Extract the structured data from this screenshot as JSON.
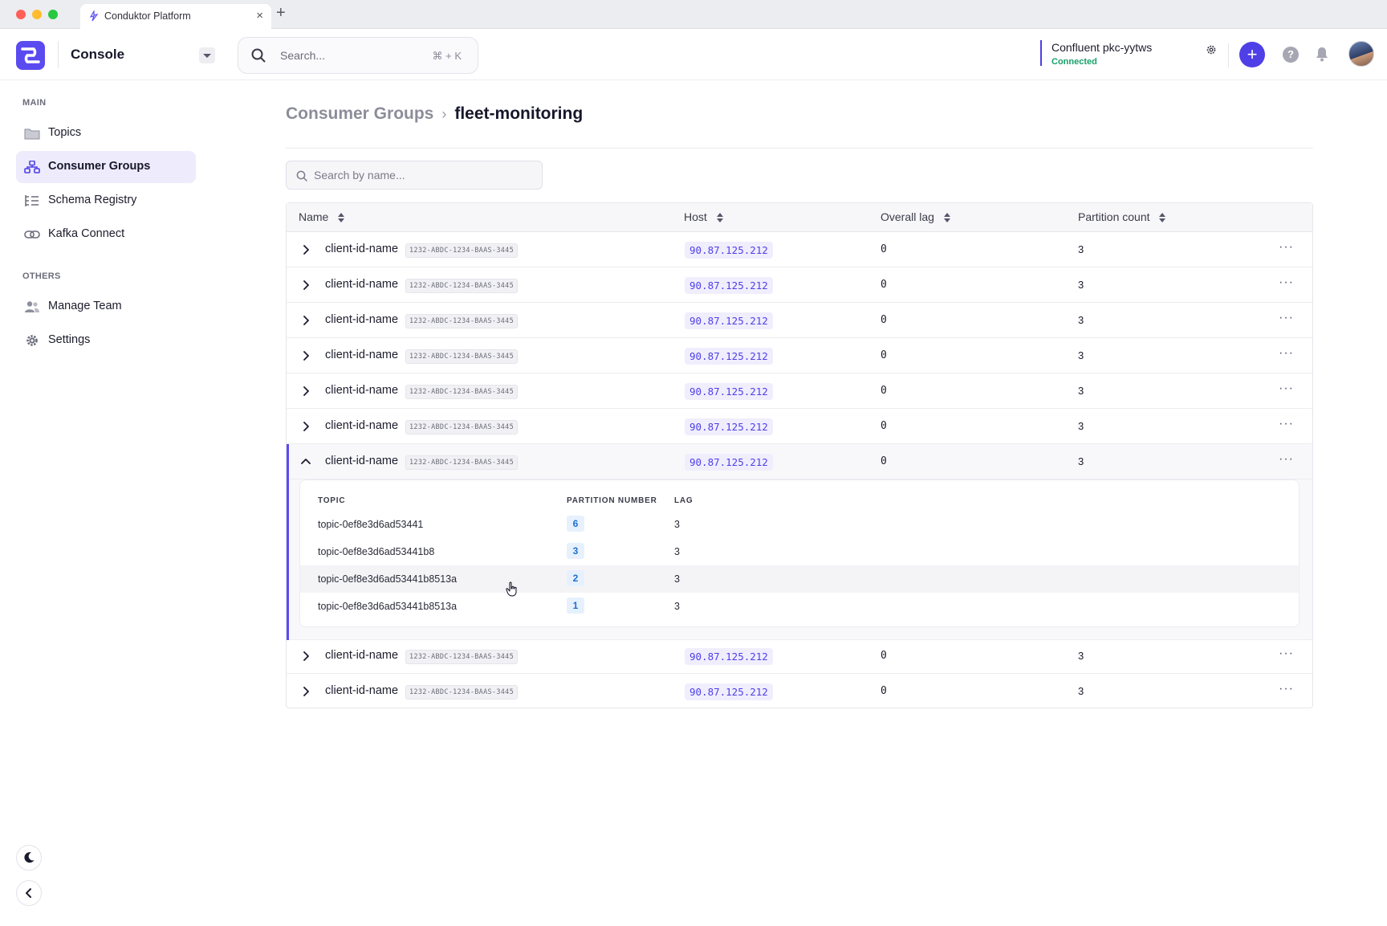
{
  "browser": {
    "tab_title": "Conduktor Platform",
    "close_glyph": "×",
    "new_tab_glyph": "+"
  },
  "header": {
    "app_name": "Console",
    "search_placeholder": "Search...",
    "search_shortcut": "⌘ + K",
    "cluster_name": "Confluent pkc-yytws",
    "cluster_status": "Connected",
    "help_glyph": "?",
    "add_glyph": "+",
    "accent_color": "#5a4bf0",
    "status_color": "#18a06a"
  },
  "sidebar": {
    "section_main": "MAIN",
    "section_others": "OTHERS",
    "items": [
      {
        "label": "Topics",
        "icon": "folder-icon"
      },
      {
        "label": "Consumer Groups",
        "icon": "consumer-groups-icon",
        "active": true
      },
      {
        "label": "Schema Registry",
        "icon": "schema-list-icon"
      },
      {
        "label": "Kafka Connect",
        "icon": "link-icon"
      },
      {
        "label": "Manage Team",
        "icon": "users-icon"
      },
      {
        "label": "Settings",
        "icon": "gear-icon"
      }
    ]
  },
  "breadcrumb": {
    "parent": "Consumer Groups",
    "separator": "›",
    "current": "fleet-monitoring"
  },
  "filter": {
    "placeholder": "Search by name..."
  },
  "table": {
    "columns": [
      "Name",
      "Host",
      "Overall lag",
      "Partition count"
    ],
    "rows": [
      {
        "name": "client-id-name",
        "id": "1232-ABDC-1234-BAAS-3445",
        "host": "90.87.125.212",
        "lag": "0",
        "partitions": "3"
      },
      {
        "name": "client-id-name",
        "id": "1232-ABDC-1234-BAAS-3445",
        "host": "90.87.125.212",
        "lag": "0",
        "partitions": "3"
      },
      {
        "name": "client-id-name",
        "id": "1232-ABDC-1234-BAAS-3445",
        "host": "90.87.125.212",
        "lag": "0",
        "partitions": "3"
      },
      {
        "name": "client-id-name",
        "id": "1232-ABDC-1234-BAAS-3445",
        "host": "90.87.125.212",
        "lag": "0",
        "partitions": "3"
      },
      {
        "name": "client-id-name",
        "id": "1232-ABDC-1234-BAAS-3445",
        "host": "90.87.125.212",
        "lag": "0",
        "partitions": "3"
      },
      {
        "name": "client-id-name",
        "id": "1232-ABDC-1234-BAAS-3445",
        "host": "90.87.125.212",
        "lag": "0",
        "partitions": "3"
      },
      {
        "name": "client-id-name",
        "id": "1232-ABDC-1234-BAAS-3445",
        "host": "90.87.125.212",
        "lag": "0",
        "partitions": "3",
        "expanded": true
      },
      {
        "name": "client-id-name",
        "id": "1232-ABDC-1234-BAAS-3445",
        "host": "90.87.125.212",
        "lag": "0",
        "partitions": "3"
      },
      {
        "name": "client-id-name",
        "id": "1232-ABDC-1234-BAAS-3445",
        "host": "90.87.125.212",
        "lag": "0",
        "partitions": "3"
      }
    ],
    "more_glyph": "···"
  },
  "expanded_detail": {
    "columns": [
      "TOPIC",
      "PARTITION NUMBER",
      "LAG"
    ],
    "rows": [
      {
        "topic": "topic-0ef8e3d6ad53441",
        "partition": "6",
        "lag": "3"
      },
      {
        "topic": "topic-0ef8e3d6ad53441b8",
        "partition": "3",
        "lag": "3"
      },
      {
        "topic": "topic-0ef8e3d6ad53441b8513a",
        "partition": "2",
        "lag": "3",
        "hovered": true
      },
      {
        "topic": "topic-0ef8e3d6ad53441b8513a",
        "partition": "1",
        "lag": "3"
      }
    ]
  }
}
